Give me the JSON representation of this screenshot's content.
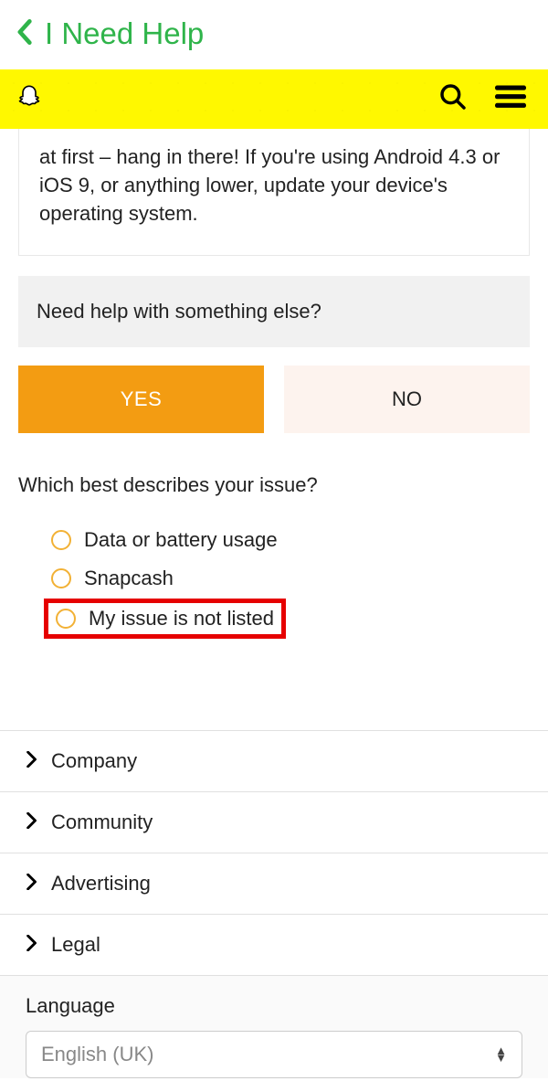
{
  "header": {
    "title": "I Need Help"
  },
  "helpText": "at first – hang in there! If you're using Android 4.3 or iOS 9, or anything lower, update your device's operating system.",
  "prompt": "Need help with something else?",
  "buttons": {
    "yes": "YES",
    "no": "NO"
  },
  "question": "Which best describes your issue?",
  "options": {
    "0": {
      "label": "Data or battery usage"
    },
    "1": {
      "label": "Snapcash"
    },
    "2": {
      "label": "My issue is not listed"
    }
  },
  "footer": {
    "items": {
      "0": "Company",
      "1": "Community",
      "2": "Advertising",
      "3": "Legal"
    },
    "languageLabel": "Language",
    "languageValue": "English (UK)"
  }
}
